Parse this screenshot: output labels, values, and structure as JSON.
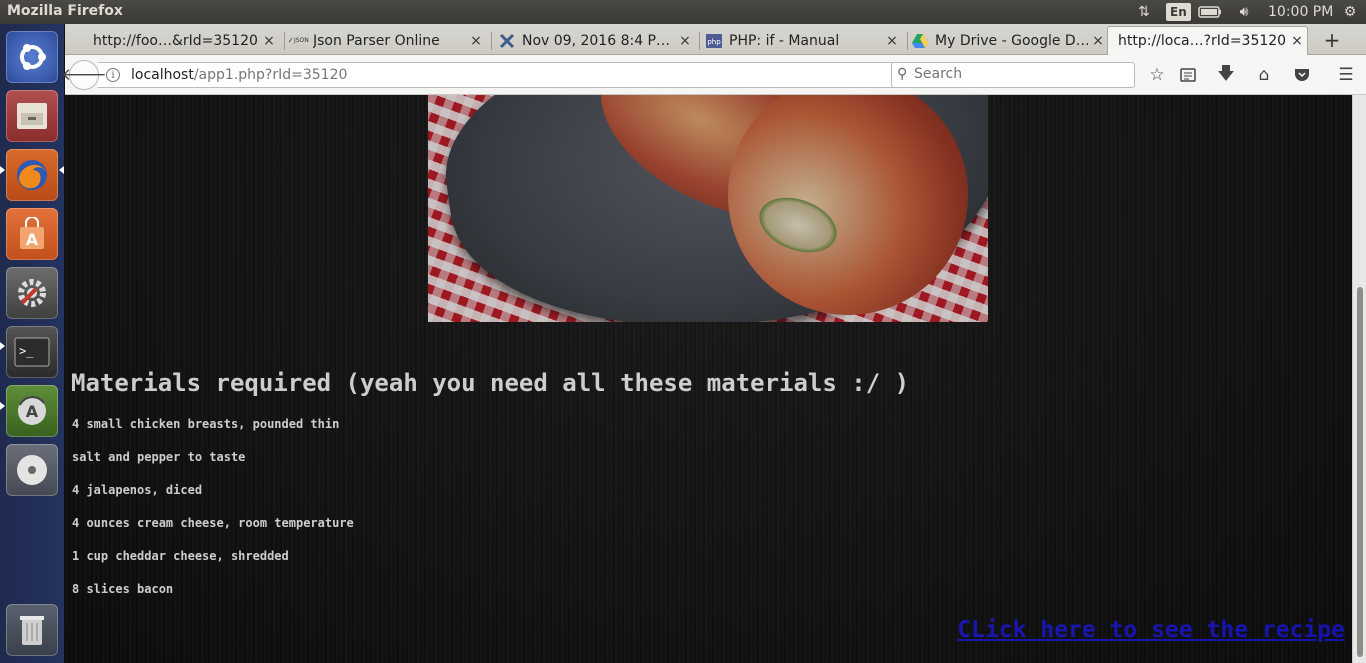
{
  "panel": {
    "app_title": "Mozilla Firefox",
    "keyboard_layout": "En",
    "clock": "10:00 PM"
  },
  "launcher": {
    "items": [
      {
        "name": "ubuntu-dash",
        "icon": "ubuntu-logo-icon"
      },
      {
        "name": "files",
        "icon": "file-cabinet-icon"
      },
      {
        "name": "firefox",
        "icon": "firefox-icon"
      },
      {
        "name": "software-center",
        "icon": "shopping-bag-icon"
      },
      {
        "name": "system-settings",
        "icon": "wrench-gear-icon"
      },
      {
        "name": "terminal",
        "icon": "terminal-icon"
      },
      {
        "name": "software-updater",
        "icon": "updater-icon"
      },
      {
        "name": "dvd",
        "icon": "disc-icon"
      },
      {
        "name": "trash",
        "icon": "trash-icon"
      }
    ]
  },
  "tabs": [
    {
      "label": "http://foo…&rId=35120",
      "icon": "page-icon",
      "active": false
    },
    {
      "label": "Json Parser Online",
      "icon": "json-icon",
      "active": false
    },
    {
      "label": "Nov 09, 2016 8:4 P…",
      "icon": "cross-icon",
      "active": false
    },
    {
      "label": "PHP: if - Manual",
      "icon": "php-icon",
      "active": false
    },
    {
      "label": "My Drive - Google D…",
      "icon": "google-drive-icon",
      "active": false
    },
    {
      "label": "http://loca…?rId=35120",
      "icon": "page-icon",
      "active": true
    }
  ],
  "tab_close_glyph": "×",
  "new_tab_glyph": "+",
  "navigation": {
    "url_host": "localhost",
    "url_path": "/app1.php?rId=35120",
    "search_placeholder": "Search"
  },
  "page": {
    "image_alt": "Bacon-wrapped jalapeño chicken on a plate",
    "materials_heading": "Materials required (yeah you need all these materials :/ )",
    "ingredients": [
      "4 small chicken breasts, pounded thin",
      "salt and pepper to taste",
      "4 jalapenos, diced",
      "4 ounces cream cheese, room temperature",
      "1 cup cheddar cheese, shredded",
      "8 slices bacon"
    ],
    "recipe_link": "CLick here to see the recipe"
  },
  "colors": {
    "link": "#1a17d8",
    "page_text": "#ffffff",
    "page_bg": "#111111"
  }
}
